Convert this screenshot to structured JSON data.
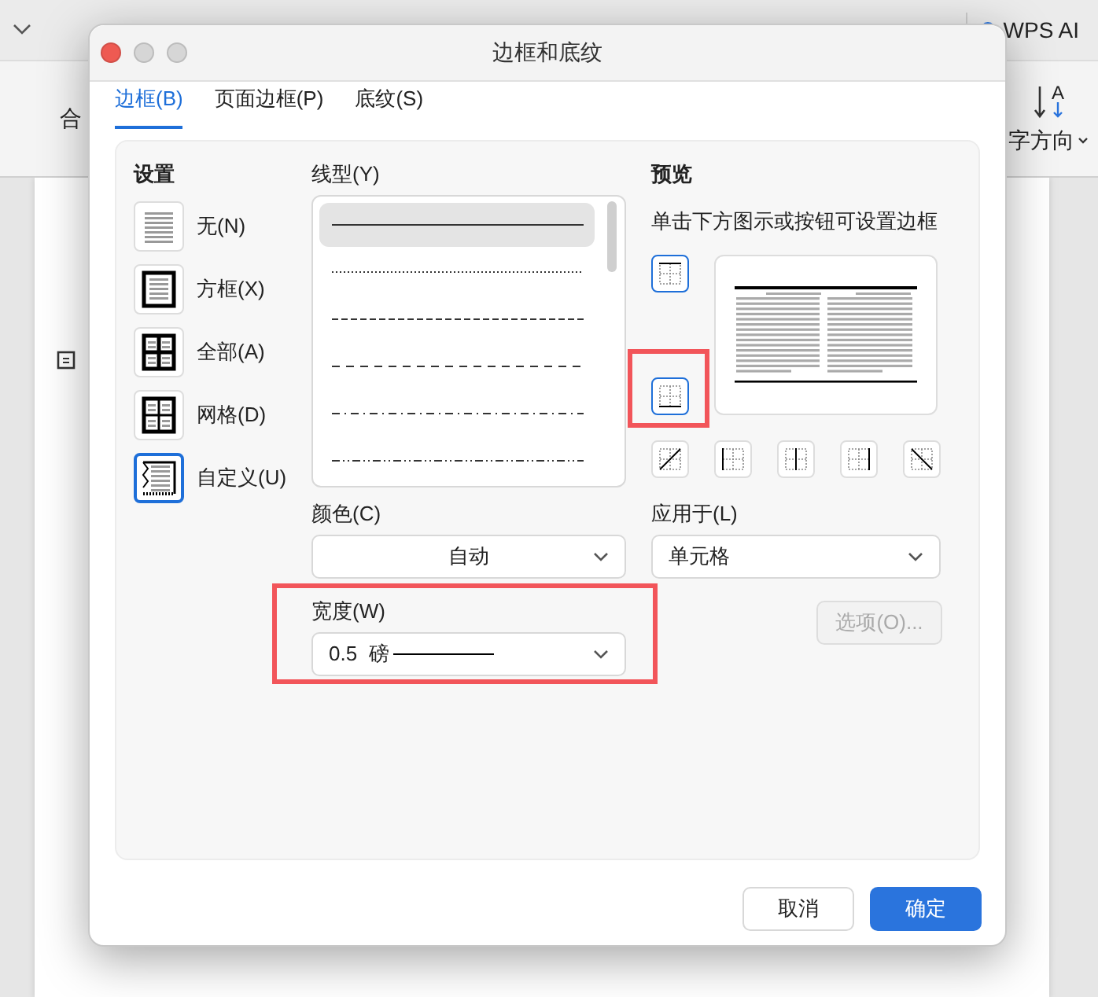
{
  "background": {
    "ribbon_left_label": "合",
    "ai_button": "WPS AI",
    "text_direction": "字方向",
    "text_direction_letter": "A"
  },
  "window": {
    "title": "边框和底纹"
  },
  "tabs": [
    {
      "label": "边框(B)",
      "selected": true
    },
    {
      "label": "页面边框(P)",
      "selected": false
    },
    {
      "label": "底纹(S)",
      "selected": false
    }
  ],
  "settings": {
    "title": "设置",
    "items": [
      {
        "kind": "none",
        "label": "无(N)",
        "selected": false
      },
      {
        "kind": "box",
        "label": "方框(X)",
        "selected": false
      },
      {
        "kind": "all",
        "label": "全部(A)",
        "selected": false
      },
      {
        "kind": "grid",
        "label": "网格(D)",
        "selected": false
      },
      {
        "kind": "custom",
        "label": "自定义(U)",
        "selected": true
      }
    ]
  },
  "line_style": {
    "title": "线型(Y)",
    "items": [
      {
        "kind": "solid",
        "selected": true
      },
      {
        "kind": "dotted",
        "selected": false
      },
      {
        "kind": "dashed",
        "selected": false
      },
      {
        "kind": "long-dash",
        "selected": false
      },
      {
        "kind": "dash-dot",
        "selected": false
      },
      {
        "kind": "dash-dot-dot",
        "selected": false
      }
    ]
  },
  "preview": {
    "title": "预览",
    "hint": "单击下方图示或按钮可设置边框",
    "side_buttons": [
      {
        "kind": "top",
        "on": true,
        "highlighted": false
      },
      {
        "kind": "bottom",
        "on": true,
        "highlighted": true
      }
    ],
    "bottom_buttons": [
      {
        "kind": "diag-up",
        "on": false
      },
      {
        "kind": "left",
        "on": false
      },
      {
        "kind": "center",
        "on": false
      },
      {
        "kind": "right",
        "on": false
      },
      {
        "kind": "diag-down",
        "on": false
      }
    ]
  },
  "color": {
    "label": "颜色(C)",
    "value": "自动"
  },
  "apply_to": {
    "label": "应用于(L)",
    "value": "单元格"
  },
  "width": {
    "label": "宽度(W)",
    "value": "0.5  磅",
    "highlighted": true
  },
  "options_button": {
    "label": "选项(O)...",
    "disabled": true
  },
  "buttons": [
    {
      "label": "取消",
      "primary": false
    },
    {
      "label": "确定",
      "primary": true
    }
  ]
}
